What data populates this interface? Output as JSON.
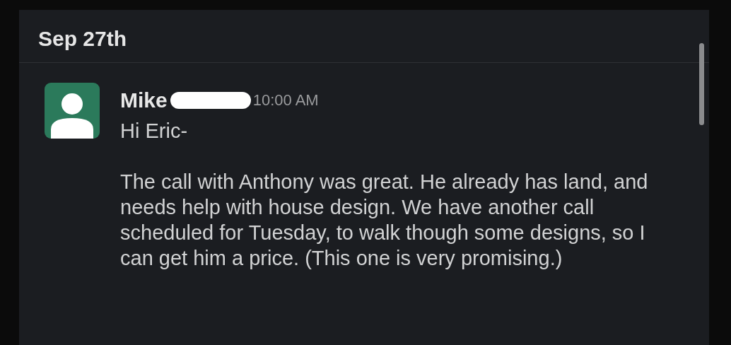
{
  "date_divider": "Sep 27th",
  "message": {
    "author": "Mike",
    "author_redacted": true,
    "time": "10:00 AM",
    "greeting": "Hi Eric-",
    "body": "The call with Anthony was great. He already has land, and needs help with house design. We have another call scheduled for Tuesday, to walk though some designs, so I can get him a price. (This one is very promising.)"
  }
}
